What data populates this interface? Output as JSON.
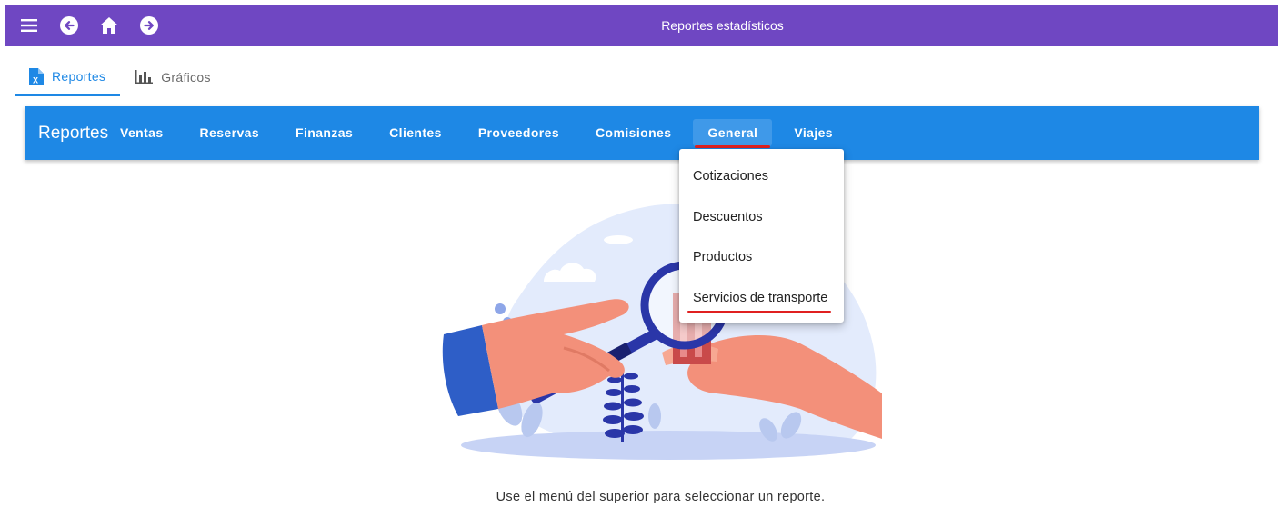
{
  "appbar": {
    "title": "Reportes estadísticos",
    "icons": [
      "menu-icon",
      "back-arrow-icon",
      "home-icon",
      "forward-arrow-icon"
    ],
    "color": "#6f47c2"
  },
  "tabs": [
    {
      "label": "Reportes",
      "icon": "excel-file-icon",
      "active": true
    },
    {
      "label": "Gráficos",
      "icon": "bar-chart-icon",
      "active": false
    }
  ],
  "toolbar": {
    "brand": "Reportes",
    "color": "#1e88e5",
    "items": [
      {
        "label": "Ventas"
      },
      {
        "label": "Reservas"
      },
      {
        "label": "Finanzas"
      },
      {
        "label": "Clientes"
      },
      {
        "label": "Proveedores"
      },
      {
        "label": "Comisiones"
      },
      {
        "label": "General",
        "selected": true
      },
      {
        "label": "Viajes"
      }
    ]
  },
  "dropdown": {
    "items": [
      {
        "label": "Cotizaciones"
      },
      {
        "label": "Descuentos"
      },
      {
        "label": "Productos"
      },
      {
        "label": "Servicios de transporte",
        "highlighted": true
      }
    ]
  },
  "empty_state": {
    "illustration": "hand-magnifier-illustration",
    "message": "Use el menú del superior para seleccionar un reporte."
  },
  "annotation_color": "#e02020"
}
